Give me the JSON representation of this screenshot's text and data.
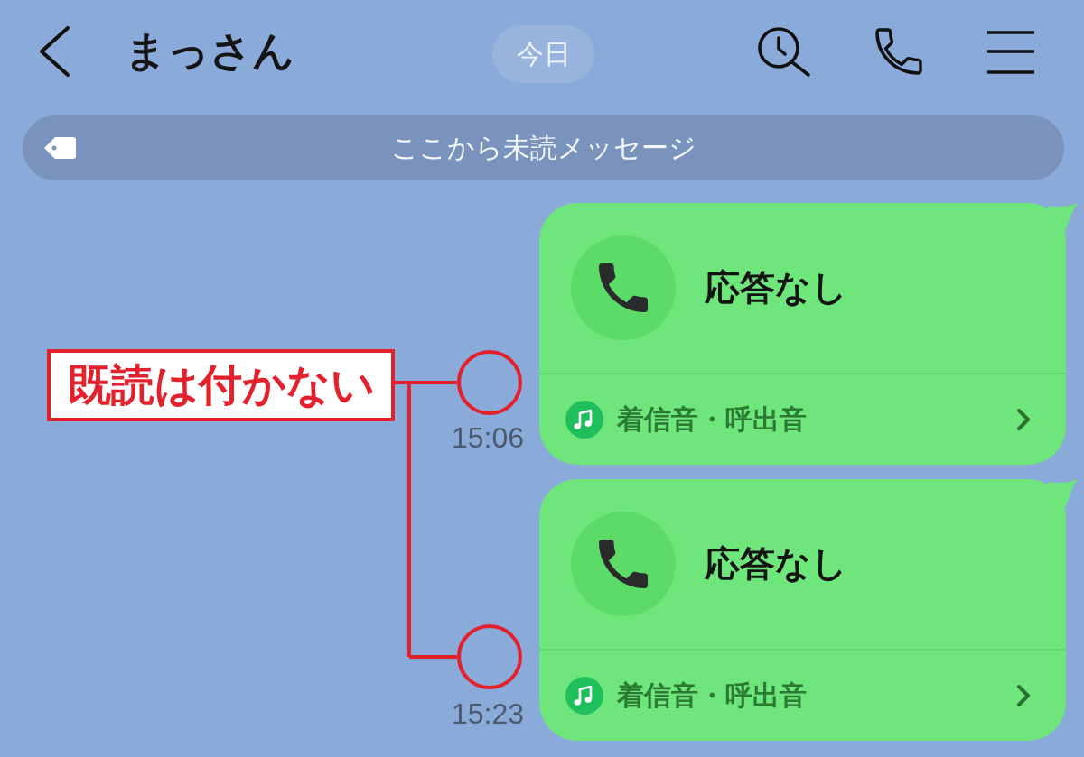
{
  "header": {
    "title": "まっさん",
    "date_label": "今日"
  },
  "unread_banner": {
    "text": "ここから未読メッセージ"
  },
  "messages": [
    {
      "title": "応答なし",
      "action": "着信音・呼出音",
      "time": "15:06"
    },
    {
      "title": "応答なし",
      "action": "着信音・呼出音",
      "time": "15:23"
    }
  ],
  "annotation": {
    "text": "既読は付かない"
  }
}
